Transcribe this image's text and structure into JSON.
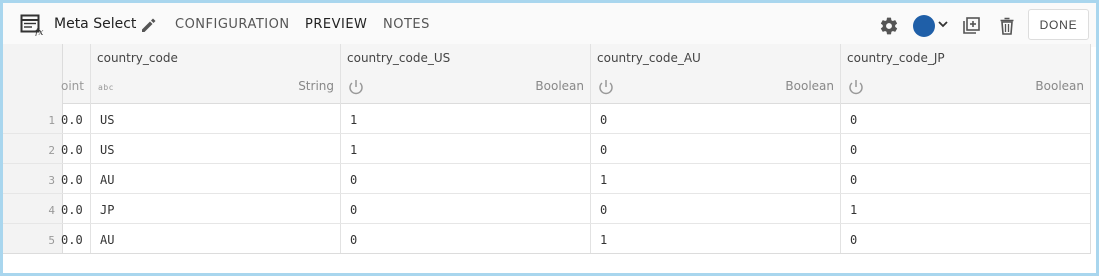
{
  "header": {
    "title": "Meta Select",
    "tabs": [
      "CONFIGURATION",
      "PREVIEW",
      "NOTES"
    ],
    "active_tab": "PREVIEW",
    "done_label": "DONE",
    "color": "#1f5fa8"
  },
  "grid": {
    "cut_column": {
      "header": "oint",
      "values": [
        "0.0",
        "0.0",
        "0.0",
        "0.0",
        "0.0"
      ]
    },
    "columns": [
      {
        "name": "country_code",
        "type": "String",
        "type_icon": "abc-icon",
        "type_icon_text": "abc"
      },
      {
        "name": "country_code_US",
        "type": "Boolean",
        "type_icon": "power-icon"
      },
      {
        "name": "country_code_AU",
        "type": "Boolean",
        "type_icon": "power-icon"
      },
      {
        "name": "country_code_JP",
        "type": "Boolean",
        "type_icon": "power-icon"
      }
    ],
    "rows": [
      {
        "num": "1",
        "cells": [
          "US",
          "1",
          "0",
          "0"
        ]
      },
      {
        "num": "2",
        "cells": [
          "US",
          "1",
          "0",
          "0"
        ]
      },
      {
        "num": "3",
        "cells": [
          "AU",
          "0",
          "1",
          "0"
        ]
      },
      {
        "num": "4",
        "cells": [
          "JP",
          "0",
          "0",
          "1"
        ]
      },
      {
        "num": "5",
        "cells": [
          "AU",
          "0",
          "1",
          "0"
        ]
      }
    ]
  }
}
